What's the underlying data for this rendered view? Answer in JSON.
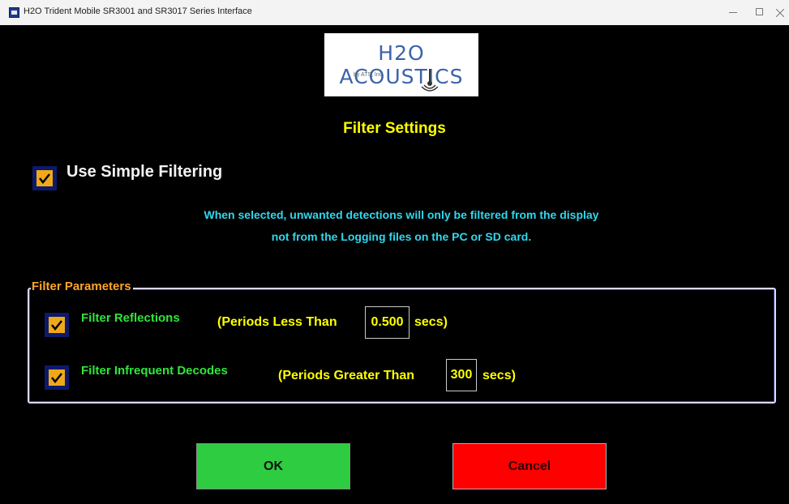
{
  "window": {
    "title": "H2O Trident Mobile SR3001 and SR3017 Series Interface",
    "icon": "app-icon",
    "controls": [
      "minimize-icon",
      "maximize-icon",
      "close-icon"
    ]
  },
  "logo": {
    "name": "H2O ACOUSTICS",
    "subtitle": "by ATS, Inc."
  },
  "heading": "Filter Settings",
  "simple_filtering": {
    "label": "Use Simple Filtering",
    "checked": true,
    "info_line_1": "When selected, unwanted detections will only be filtered from the display",
    "info_line_2": "not from the Logging files on the PC or SD card."
  },
  "filter_parameters": {
    "legend": "Filter Parameters",
    "reflections": {
      "label": "Filter Reflections",
      "checked": true,
      "prefix": "(Periods Less Than",
      "value": "0.500",
      "suffix": "secs)"
    },
    "infrequent": {
      "label": "Filter Infrequent Decodes",
      "checked": true,
      "prefix": "(Periods Greater Than",
      "value": "300",
      "suffix": "secs)"
    }
  },
  "buttons": {
    "ok": "OK",
    "cancel": "Cancel"
  },
  "colors": {
    "background": "#000000",
    "heading": "#ffff00",
    "info": "#2fd8ee",
    "legend": "#ffa52c",
    "param_label": "#2ee63a",
    "checkbox": "#f0a81a",
    "ok_button": "#2ecc40",
    "cancel_button": "#ff0000"
  }
}
